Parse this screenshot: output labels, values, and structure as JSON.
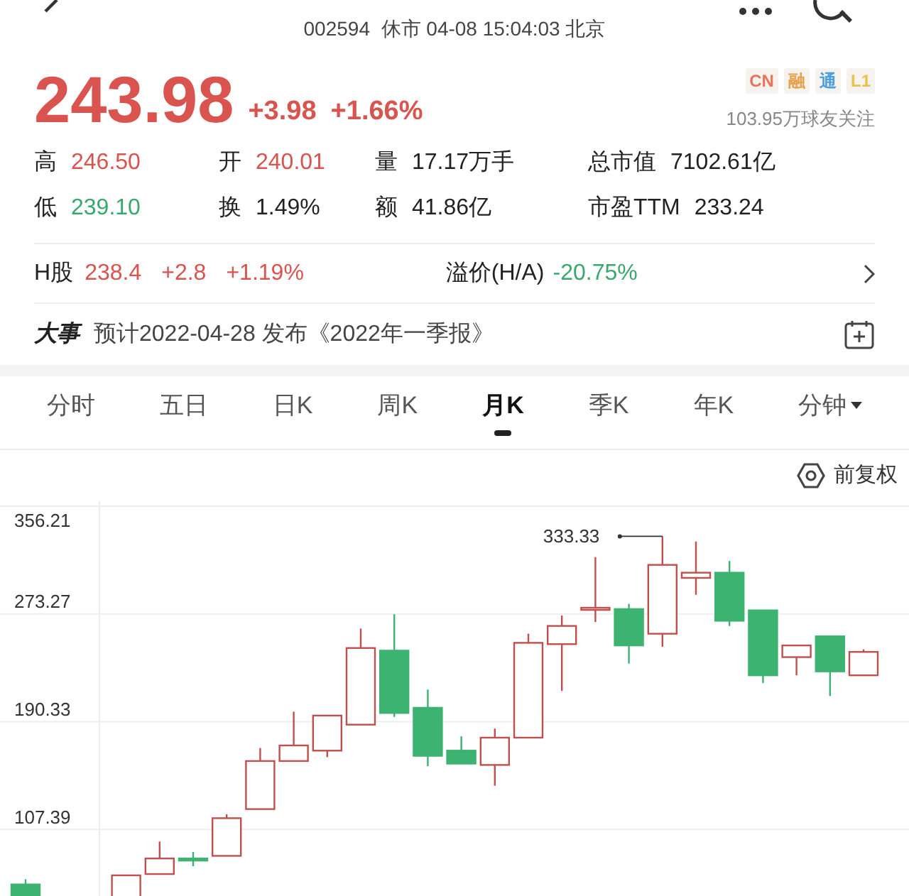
{
  "header": {
    "subtitle": "002594  休市 04-08 15:04:03 北京"
  },
  "quote": {
    "price": "243.98",
    "change": "+3.98",
    "change_pct": "+1.66%",
    "color": "#d9534f",
    "badges": [
      {
        "label": "CN",
        "color": "#e8735a"
      },
      {
        "label": "融",
        "color": "#e8a04a"
      },
      {
        "label": "通",
        "color": "#4a9fe0"
      },
      {
        "label": "L1",
        "color": "#e8c24a"
      }
    ],
    "followers": "103.95万球友关注"
  },
  "stats": [
    {
      "label": "高",
      "value": "246.50",
      "color": "#d9534f"
    },
    {
      "label": "开",
      "value": "240.01",
      "color": "#d9534f"
    },
    {
      "label": "量",
      "value": "17.17万手",
      "color": "#222222"
    },
    {
      "label": "总市值",
      "value": "7102.61亿",
      "color": "#222222"
    },
    {
      "label": "低",
      "value": "239.10",
      "color": "#3aa76d"
    },
    {
      "label": "换",
      "value": "1.49%",
      "color": "#222222"
    },
    {
      "label": "额",
      "value": "41.86亿",
      "color": "#222222"
    },
    {
      "label": "市盈TTM",
      "value": "233.24",
      "color": "#222222"
    }
  ],
  "h_share": {
    "label": "H股",
    "price": "238.4",
    "change": "+2.8",
    "change_pct": "+1.19%",
    "color": "#d9534f",
    "premium": {
      "label": "溢价(H/A)",
      "value": "-20.75%",
      "color": "#3aa76d"
    }
  },
  "event": {
    "label": "大事",
    "text": "预计2022-04-28 发布《2022年一季报》"
  },
  "tabs": [
    {
      "label": "分时",
      "selected": false
    },
    {
      "label": "五日",
      "selected": false
    },
    {
      "label": "日K",
      "selected": false
    },
    {
      "label": "周K",
      "selected": false
    },
    {
      "label": "月K",
      "selected": true
    },
    {
      "label": "季K",
      "selected": false
    },
    {
      "label": "年K",
      "selected": false
    },
    {
      "label": "分钟",
      "selected": false,
      "dropdown": true
    }
  ],
  "adjust": {
    "label": "前复权"
  },
  "chart": {
    "axis_labels": [
      "356.21",
      "273.27",
      "190.33",
      "107.39"
    ],
    "max_label": "333.33"
  }
}
